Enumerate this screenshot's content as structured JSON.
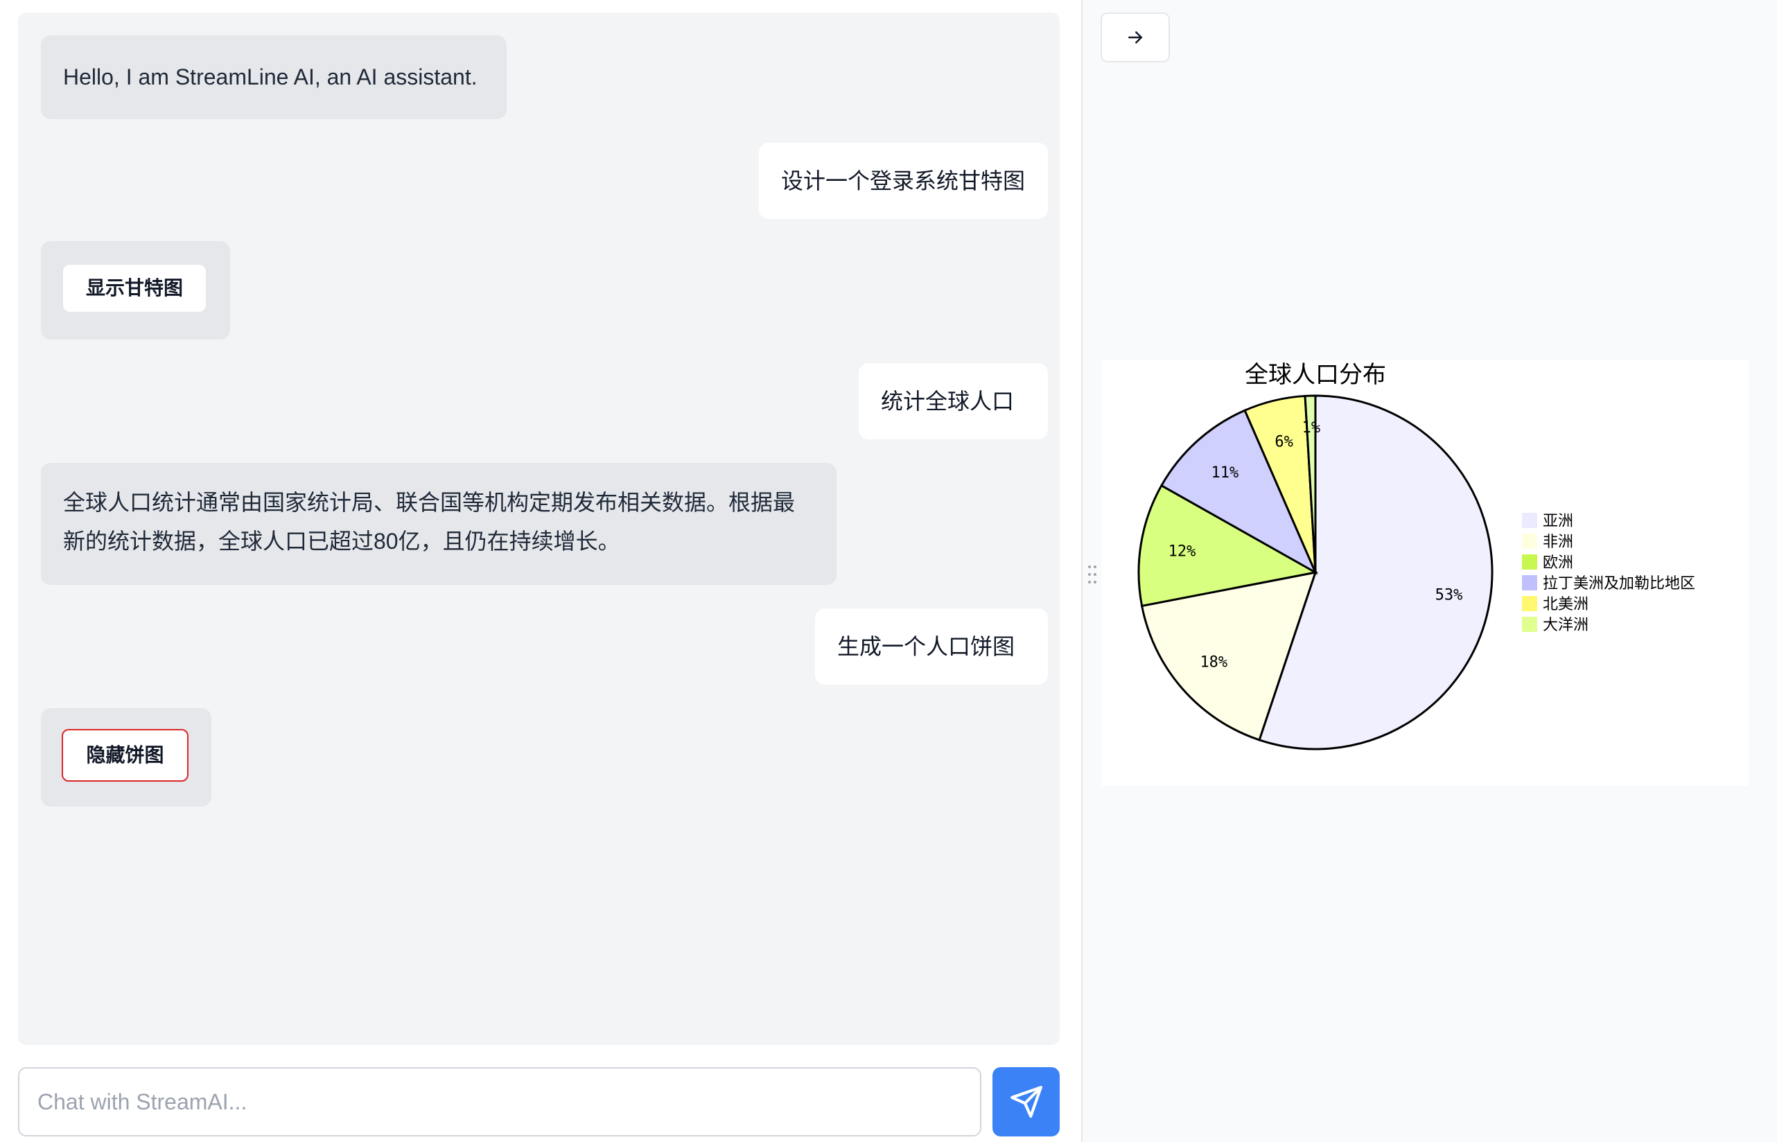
{
  "chat": {
    "messages": [
      {
        "role": "ai",
        "text": "Hello, I am StreamLine AI, an AI assistant."
      },
      {
        "role": "user",
        "text": "设计一个登录系统甘特图"
      },
      {
        "role": "ai",
        "button_label": "显示甘特图"
      },
      {
        "role": "user",
        "text": "统计全球人口"
      },
      {
        "role": "ai",
        "lines": [
          "全球人口统计通常由国家统计局、联合国等机构定期发布相关数据。根据最",
          "新的统计数据，全球人口已超过80亿，且仍在持续增长。"
        ]
      },
      {
        "role": "user",
        "text": "生成一个人口饼图"
      },
      {
        "role": "ai",
        "button_label": "隐藏饼图"
      }
    ],
    "input": {
      "placeholder": "Chat with StreamAI...",
      "value": ""
    },
    "send_icon": "send-icon"
  },
  "right_panel": {
    "collapse_icon": "arrow-right-icon"
  },
  "chart_data": {
    "type": "pie",
    "title": "全球人口分布",
    "categories": [
      "亚洲",
      "非洲",
      "欧洲",
      "拉丁美洲及加勒比地区",
      "北美洲",
      "大洋洲"
    ],
    "values": [
      59,
      18,
      12,
      11,
      6,
      1
    ],
    "slice_labels": [
      "53%",
      "18%",
      "12%",
      "11%",
      "6%",
      "1%"
    ],
    "colors": [
      "#f0f0ff",
      "#ffffe8",
      "#d8ff80",
      "#d0d0ff",
      "#ffff90",
      "#e0ffb0"
    ],
    "legend_colors": [
      "#ebebff",
      "#ffffe0",
      "#c8f850",
      "#c0c0ff",
      "#fff870",
      "#e0ff90"
    ],
    "legend": "right"
  }
}
